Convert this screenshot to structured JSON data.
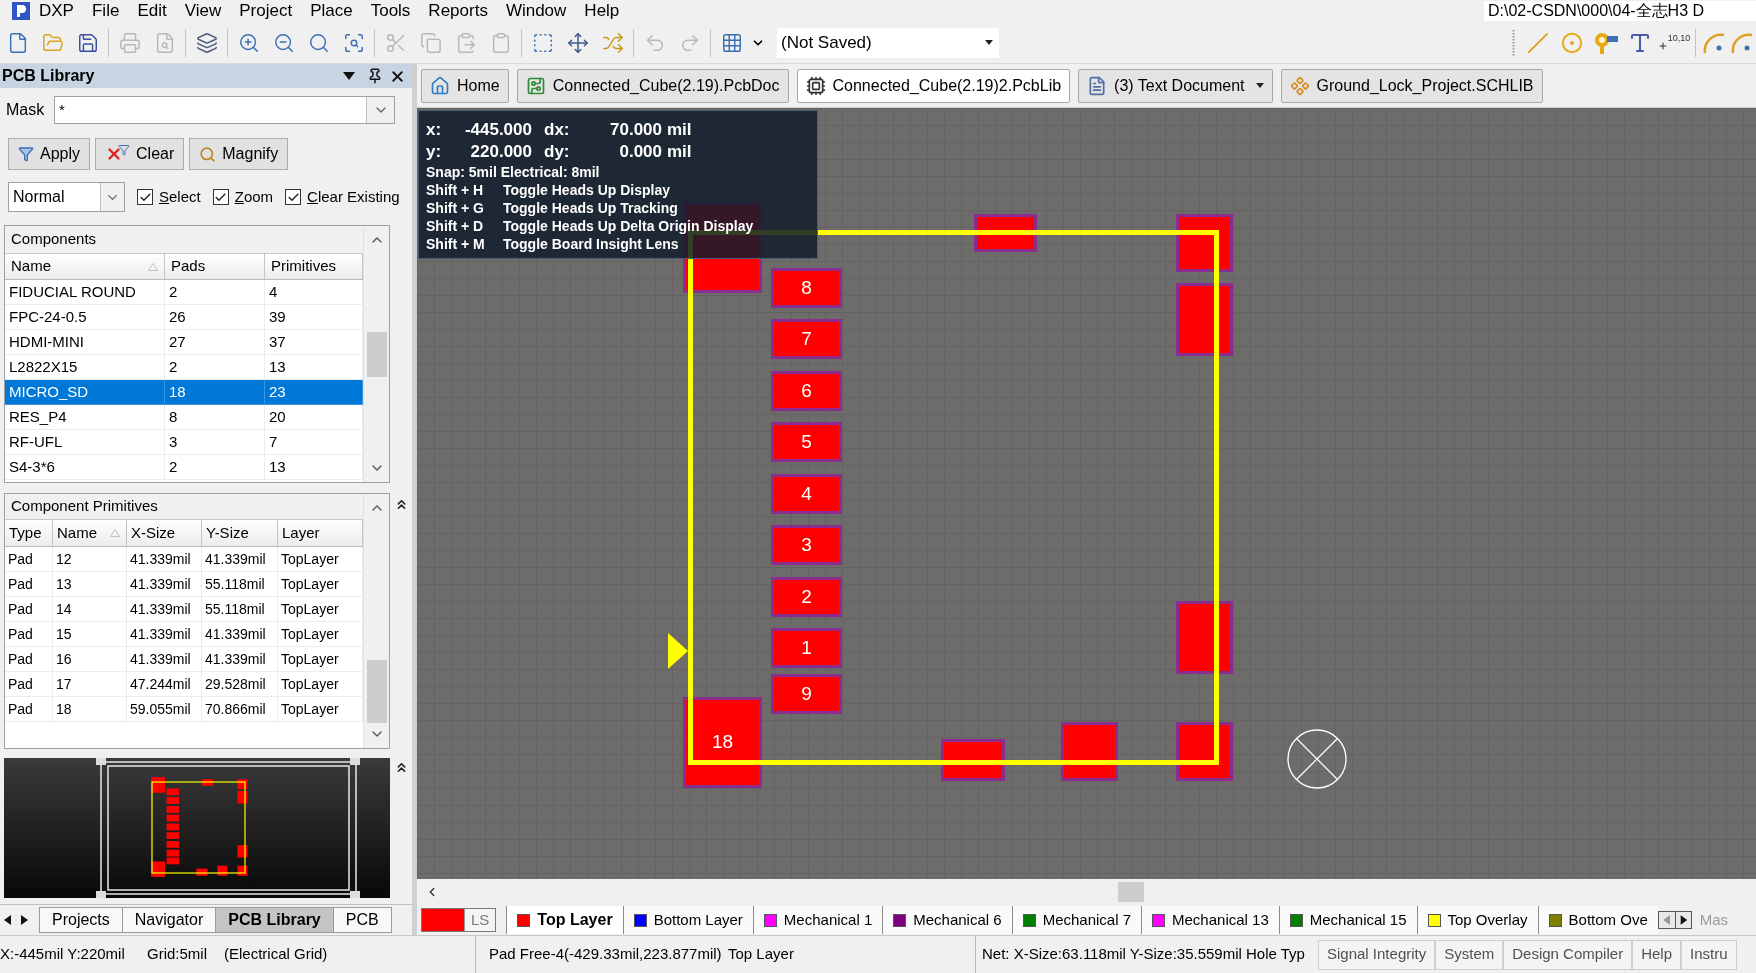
{
  "menu_bar": {
    "items": [
      "DXP",
      "File",
      "Edit",
      "View",
      "Project",
      "Place",
      "Tools",
      "Reports",
      "Window",
      "Help"
    ],
    "path": "D:\\02-CSDN\\000\\04-全志H3 D"
  },
  "toolbar": {
    "groups": [
      [
        {
          "kind": "new",
          "disabled": false
        },
        {
          "kind": "open",
          "disabled": false
        },
        {
          "kind": "save",
          "disabled": false
        }
      ],
      [
        {
          "kind": "print",
          "disabled": true
        },
        {
          "kind": "preview",
          "disabled": true
        }
      ],
      [
        {
          "kind": "view3d",
          "disabled": false
        }
      ],
      [
        {
          "kind": "zoom_in",
          "disabled": false
        },
        {
          "kind": "zoom_out",
          "disabled": false
        },
        {
          "kind": "zoom_fit",
          "disabled": false
        },
        {
          "kind": "zoom_area",
          "disabled": false
        }
      ],
      [
        {
          "kind": "cut",
          "disabled": true
        },
        {
          "kind": "copy",
          "disabled": true
        },
        {
          "kind": "paste",
          "disabled": true
        },
        {
          "kind": "stamp",
          "disabled": true
        }
      ],
      [
        {
          "kind": "select_area",
          "disabled": false
        },
        {
          "kind": "move",
          "disabled": false
        },
        {
          "kind": "deselect",
          "disabled": false
        }
      ],
      [
        {
          "kind": "undo",
          "disabled": true
        },
        {
          "kind": "redo",
          "disabled": true
        }
      ],
      [
        {
          "kind": "grid",
          "disabled": false
        }
      ]
    ],
    "view_dropdown": "(Not Saved)",
    "place_groups": [
      [
        {
          "kind": "line"
        },
        {
          "kind": "pad"
        },
        {
          "kind": "via"
        },
        {
          "kind": "text"
        },
        {
          "kind": "coordinate",
          "label": "10,10"
        }
      ],
      [
        {
          "kind": "arc"
        },
        {
          "kind": "arc"
        }
      ]
    ]
  },
  "panel": {
    "title": "PCB Library",
    "mask": {
      "label": "Mask",
      "value": "*"
    },
    "buttons": [
      {
        "kind": "apply",
        "label": "Apply"
      },
      {
        "kind": "clear",
        "label": "Clear"
      },
      {
        "kind": "magnify",
        "label": "Magnify"
      }
    ],
    "mode": "Normal",
    "options": [
      {
        "label": "Select",
        "checked": true
      },
      {
        "label": "Zoom",
        "checked": true
      },
      {
        "label": "Clear Existing",
        "checked": true
      }
    ],
    "components": {
      "title": "Components",
      "columns": [
        "Name",
        "Pads",
        "Primitives"
      ],
      "rows": [
        {
          "cells": [
            "FIDUCIAL ROUND",
            "2",
            "4"
          ],
          "selected": false
        },
        {
          "cells": [
            "FPC-24-0.5",
            "26",
            "39"
          ],
          "selected": false
        },
        {
          "cells": [
            "HDMI-MINI",
            "27",
            "37"
          ],
          "selected": false
        },
        {
          "cells": [
            "L2822X15",
            "2",
            "13"
          ],
          "selected": false
        },
        {
          "cells": [
            "MICRO_SD",
            "18",
            "23"
          ],
          "selected": true
        },
        {
          "cells": [
            "RES_P4",
            "8",
            "20"
          ],
          "selected": false
        },
        {
          "cells": [
            "RF-UFL",
            "3",
            "7"
          ],
          "selected": false
        },
        {
          "cells": [
            "S4-3*6",
            "2",
            "13"
          ],
          "selected": false
        }
      ]
    },
    "primitives": {
      "title": "Component Primitives",
      "columns": [
        "Type",
        "Name",
        "X-Size",
        "Y-Size",
        "Layer"
      ],
      "rows": [
        [
          "Pad",
          "12",
          "41.339mil",
          "41.339mil",
          "TopLayer"
        ],
        [
          "Pad",
          "13",
          "41.339mil",
          "55.118mil",
          "TopLayer"
        ],
        [
          "Pad",
          "14",
          "41.339mil",
          "55.118mil",
          "TopLayer"
        ],
        [
          "Pad",
          "15",
          "41.339mil",
          "41.339mil",
          "TopLayer"
        ],
        [
          "Pad",
          "16",
          "41.339mil",
          "41.339mil",
          "TopLayer"
        ],
        [
          "Pad",
          "17",
          "47.244mil",
          "29.528mil",
          "TopLayer"
        ],
        [
          "Pad",
          "18",
          "59.055mil",
          "70.866mil",
          "TopLayer"
        ]
      ]
    },
    "tabs": [
      {
        "label": "Projects",
        "selected": false
      },
      {
        "label": "Navigator",
        "selected": false
      },
      {
        "label": "PCB Library",
        "selected": true
      },
      {
        "label": "PCB",
        "selected": false
      }
    ]
  },
  "document_tabs": [
    {
      "kind": "home",
      "label": "Home",
      "selected": false,
      "has_menu": false
    },
    {
      "kind": "pcb",
      "label": "Connected_Cube(2.19).PcbDoc",
      "selected": false,
      "has_menu": false
    },
    {
      "kind": "pcblib",
      "label": "Connected_Cube(2.19)2.PcbLib",
      "selected": true,
      "has_menu": false
    },
    {
      "kind": "text",
      "label": "(3) Text Document",
      "selected": false,
      "has_menu": true
    },
    {
      "kind": "schlib",
      "label": "Ground_Lock_Project.SCHLIB",
      "selected": false,
      "has_menu": false
    }
  ],
  "canvas": {
    "heads_up": {
      "coordinates": [
        {
          "axis": "x:",
          "value": "-445.000",
          "delta_axis": "dx:",
          "delta": "70.000",
          "unit": "mil"
        },
        {
          "axis": "y:",
          "value": "220.000",
          "delta_axis": "dy:",
          "delta": "0.000",
          "unit": "mil"
        }
      ],
      "snap": "Snap: 5mil Electrical: 8mil",
      "shortcuts": [
        {
          "keys": "Shift + H",
          "action": "Toggle Heads Up Display"
        },
        {
          "keys": "Shift + G",
          "action": "Toggle Heads Up Tracking"
        },
        {
          "keys": "Shift + D",
          "action": "Toggle Heads Up Delta Origin Display"
        },
        {
          "keys": "Shift + M",
          "action": "Toggle Board Insight Lens"
        }
      ]
    },
    "pads": [
      {
        "label": "8"
      },
      {
        "label": "7"
      },
      {
        "label": "6"
      },
      {
        "label": "5"
      },
      {
        "label": "4"
      },
      {
        "label": "3"
      },
      {
        "label": "2"
      },
      {
        "label": "1"
      },
      {
        "label": "9"
      },
      {
        "label": "18"
      }
    ]
  },
  "layer_tabs": {
    "current": {
      "color": "#ff0000",
      "label": "LS"
    },
    "tabs": [
      {
        "label": "Top Layer",
        "color": "#ff0000",
        "selected": true
      },
      {
        "label": "Bottom Layer",
        "color": "#0000ff",
        "selected": false
      },
      {
        "label": "Mechanical 1",
        "color": "#ff00ff",
        "selected": false
      },
      {
        "label": "Mechanical 6",
        "color": "#800080",
        "selected": false
      },
      {
        "label": "Mechanical 7",
        "color": "#008000",
        "selected": false
      },
      {
        "label": "Mechanical 13",
        "color": "#ff00ff",
        "selected": false
      },
      {
        "label": "Mechanical 15",
        "color": "#008000",
        "selected": false
      },
      {
        "label": "Top Overlay",
        "color": "#ffff00",
        "selected": false
      },
      {
        "label": "Bottom Ove",
        "color": "#808000",
        "selected": false
      }
    ],
    "overflow": "Mas"
  },
  "status_bar": {
    "cursor": "X:-445mil Y:220mil",
    "grid": "Grid:5mil",
    "grid_type": "(Electrical Grid)",
    "object": "Pad Free-4(-429.33mil,223.877mil)",
    "layer": "Top Layer",
    "size_info": "Net: X-Size:63.118mil Y-Size:35.559mil Hole Typ",
    "panel_buttons": [
      "Signal Integrity",
      "System",
      "Design Compiler",
      "Help",
      "Instru"
    ]
  }
}
